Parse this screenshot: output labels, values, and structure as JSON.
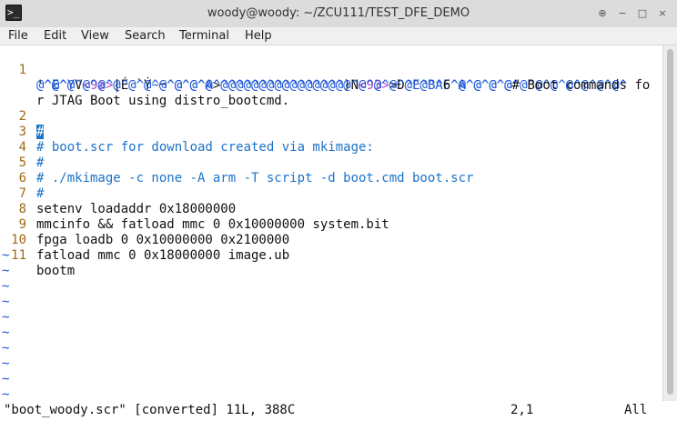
{
  "window": {
    "title": "woody@woody: ~/ZCU111/TEST_DFE_DEMO",
    "icon": "terminal-icon",
    "controls": [
      "⊕",
      "−",
      "□",
      "×"
    ]
  },
  "menu": [
    "File",
    "Edit",
    "View",
    "Search",
    "Terminal",
    "Help"
  ],
  "editor": {
    "line1_parts": [
      {
        "t": "'",
        "c": "n"
      },
      {
        "t": "^E^Y",
        "c": "ctl"
      },
      {
        "t": "V",
        "c": "n"
      },
      {
        "t": "<9a>",
        "c": "hex"
      },
      {
        "t": "|É `Ý",
        "c": "n"
      },
      {
        "t": "~",
        "c": "ctl"
      },
      {
        "t": "¬",
        "c": "n"
      },
      {
        "t": "^@^@^A",
        "c": "ctl"
      },
      {
        "t": ">",
        "c": "n"
      },
      {
        "t": "^@^@^@^@^@^@^@^@",
        "c": "ctl"
      },
      {
        "t": ")N",
        "c": "n"
      },
      {
        "t": "<93>",
        "c": "hex"
      },
      {
        "t": ">Ð",
        "c": "n"
      },
      {
        "t": "^E^B^F^A^@^@^@^@^@^@^@^@^@^@^",
        "c": "ctl"
      }
    ],
    "line1_wrap1_parts": [
      {
        "t": "@^@^@^@^@^@^@^@^@^@^@^@^@^@^@^@^@^@^@^@^@^@^@^@^@^@^A",
        "c": "ctl"
      },
      {
        "t": "6",
        "c": "n"
      },
      {
        "t": "^@^@^@^@",
        "c": "ctl"
      },
      {
        "t": "# Boot commands fo",
        "c": "n"
      }
    ],
    "line1_wrap2": "r JTAG Boot using distro_bootcmd.",
    "lines": [
      {
        "num": "1",
        "text": ""
      },
      {
        "num": "2",
        "text": "#"
      },
      {
        "num": "3",
        "text": "# boot.scr for download created via mkimage:"
      },
      {
        "num": "4",
        "text": "#"
      },
      {
        "num": "5",
        "text": "# ./mkimage -c none -A arm -T script -d boot.cmd boot.scr"
      },
      {
        "num": "6",
        "text": "#"
      },
      {
        "num": "7",
        "text": "setenv loadaddr 0x18000000"
      },
      {
        "num": "8",
        "text": "mmcinfo && fatload mmc 0 0x10000000 system.bit"
      },
      {
        "num": "9",
        "text": "fpga loadb 0 0x10000000 0x2100000"
      },
      {
        "num": "10",
        "text": "fatload mmc 0 0x18000000 image.ub"
      },
      {
        "num": "11",
        "text": "bootm"
      }
    ],
    "tilde": "~"
  },
  "status": {
    "file": "\"boot_woody.scr\" [converted] 11L, 388C",
    "position": "2,1",
    "scroll": "All"
  },
  "colors": {
    "line_number": "#a06a17",
    "comment": "#1c73c9",
    "control_char": "#1a55d6",
    "hex_escape": "#a64bd1"
  }
}
